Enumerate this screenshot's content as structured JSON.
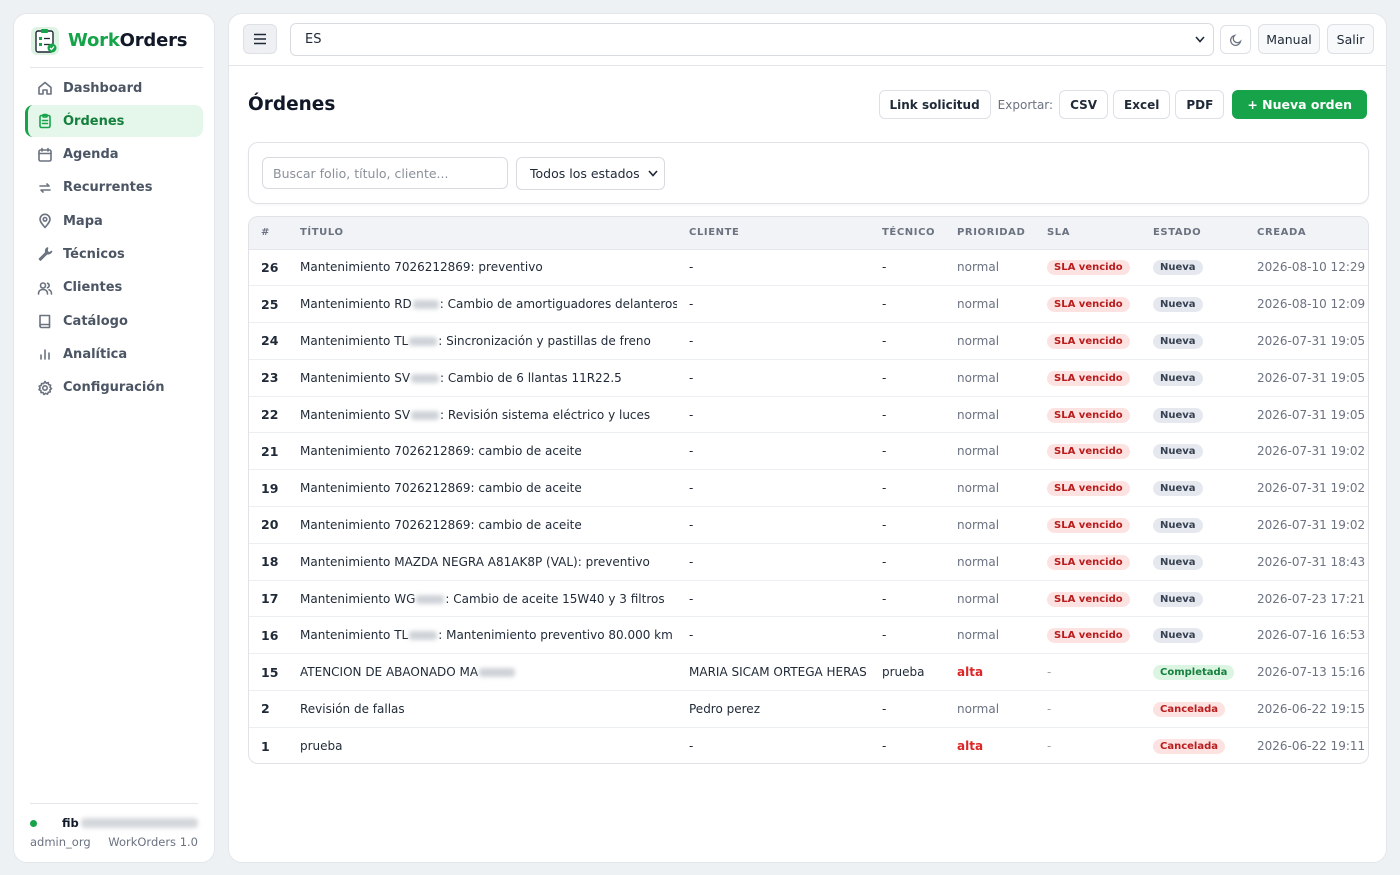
{
  "brand": {
    "name_part1": "Work",
    "name_part2": "Orders"
  },
  "sidebar": {
    "items": [
      {
        "label": "Dashboard",
        "icon": "home-icon"
      },
      {
        "label": "Órdenes",
        "icon": "clipboard-icon",
        "active": true
      },
      {
        "label": "Agenda",
        "icon": "calendar-icon"
      },
      {
        "label": "Recurrentes",
        "icon": "repeat-icon"
      },
      {
        "label": "Mapa",
        "icon": "map-pin-icon"
      },
      {
        "label": "Técnicos",
        "icon": "wrench-icon"
      },
      {
        "label": "Clientes",
        "icon": "users-icon"
      },
      {
        "label": "Catálogo",
        "icon": "book-icon"
      },
      {
        "label": "Analítica",
        "icon": "bar-chart-icon"
      },
      {
        "label": "Configuración",
        "icon": "gear-icon"
      }
    ],
    "user": {
      "name_visible": "fib",
      "role": "admin_org",
      "version": "WorkOrders 1.0"
    }
  },
  "topbar": {
    "language": "ES",
    "manual_label": "Manual",
    "logout_label": "Salir"
  },
  "page": {
    "title": "Órdenes",
    "link_button": "Link solicitud",
    "export_label": "Exportar:",
    "export_csv": "CSV",
    "export_excel": "Excel",
    "export_pdf": "PDF",
    "new_order_button": "+ Nueva orden"
  },
  "filters": {
    "search_placeholder": "Buscar folio, título, cliente...",
    "state_selected": "Todos los estados"
  },
  "table": {
    "columns": [
      "#",
      "TÍTULO",
      "CLIENTE",
      "TÉCNICO",
      "PRIORIDAD",
      "SLA",
      "ESTADO",
      "CREADA"
    ],
    "rows": [
      {
        "id": "26",
        "title_pre": "Mantenimiento 7026212869: preventivo",
        "title_post": "",
        "blur": 0,
        "client": "-",
        "tech": "-",
        "priority": "normal",
        "sla": "SLA vencido",
        "state": "Nueva",
        "state_kind": "nueva",
        "created": "2026-08-10 12:29"
      },
      {
        "id": "25",
        "title_pre": "Mantenimiento RD",
        "title_post": ": Cambio de amortiguadores delanteros",
        "blur": 26,
        "client": "-",
        "tech": "-",
        "priority": "normal",
        "sla": "SLA vencido",
        "state": "Nueva",
        "state_kind": "nueva",
        "created": "2026-08-10 12:09"
      },
      {
        "id": "24",
        "title_pre": "Mantenimiento TL",
        "title_post": ": Sincronización y pastillas de freno",
        "blur": 28,
        "client": "-",
        "tech": "-",
        "priority": "normal",
        "sla": "SLA vencido",
        "state": "Nueva",
        "state_kind": "nueva",
        "created": "2026-07-31 19:05"
      },
      {
        "id": "23",
        "title_pre": "Mantenimiento SV",
        "title_post": ": Cambio de 6 llantas 11R22.5",
        "blur": 28,
        "client": "-",
        "tech": "-",
        "priority": "normal",
        "sla": "SLA vencido",
        "state": "Nueva",
        "state_kind": "nueva",
        "created": "2026-07-31 19:05"
      },
      {
        "id": "22",
        "title_pre": "Mantenimiento SV",
        "title_post": ": Revisión sistema eléctrico y luces",
        "blur": 28,
        "client": "-",
        "tech": "-",
        "priority": "normal",
        "sla": "SLA vencido",
        "state": "Nueva",
        "state_kind": "nueva",
        "created": "2026-07-31 19:05"
      },
      {
        "id": "21",
        "title_pre": "Mantenimiento 7026212869: cambio de aceite",
        "title_post": "",
        "blur": 0,
        "client": "-",
        "tech": "-",
        "priority": "normal",
        "sla": "SLA vencido",
        "state": "Nueva",
        "state_kind": "nueva",
        "created": "2026-07-31 19:02"
      },
      {
        "id": "19",
        "title_pre": "Mantenimiento 7026212869: cambio de aceite",
        "title_post": "",
        "blur": 0,
        "client": "-",
        "tech": "-",
        "priority": "normal",
        "sla": "SLA vencido",
        "state": "Nueva",
        "state_kind": "nueva",
        "created": "2026-07-31 19:02"
      },
      {
        "id": "20",
        "title_pre": "Mantenimiento 7026212869: cambio de aceite",
        "title_post": "",
        "blur": 0,
        "client": "-",
        "tech": "-",
        "priority": "normal",
        "sla": "SLA vencido",
        "state": "Nueva",
        "state_kind": "nueva",
        "created": "2026-07-31 19:02"
      },
      {
        "id": "18",
        "title_pre": "Mantenimiento MAZDA NEGRA A81AK8P (VAL): preventivo",
        "title_post": "",
        "blur": 0,
        "client": "-",
        "tech": "-",
        "priority": "normal",
        "sla": "SLA vencido",
        "state": "Nueva",
        "state_kind": "nueva",
        "created": "2026-07-31 18:43"
      },
      {
        "id": "17",
        "title_pre": "Mantenimiento WG",
        "title_post": ": Cambio de aceite 15W40 y 3 filtros",
        "blur": 28,
        "client": "-",
        "tech": "-",
        "priority": "normal",
        "sla": "SLA vencido",
        "state": "Nueva",
        "state_kind": "nueva",
        "created": "2026-07-23 17:21"
      },
      {
        "id": "16",
        "title_pre": "Mantenimiento TL",
        "title_post": ": Mantenimiento preventivo 80.000 km",
        "blur": 28,
        "client": "-",
        "tech": "-",
        "priority": "normal",
        "sla": "SLA vencido",
        "state": "Nueva",
        "state_kind": "nueva",
        "created": "2026-07-16 16:53"
      },
      {
        "id": "15",
        "title_pre": "ATENCION DE ABAONADO MA",
        "title_post": "",
        "blur": 36,
        "client": "MARIA SICAM ORTEGA HERAS",
        "tech": "prueba",
        "priority": "alta",
        "sla": "-",
        "state": "Completada",
        "state_kind": "completada",
        "created": "2026-07-13 15:16"
      },
      {
        "id": "2",
        "title_pre": "Revisión de fallas",
        "title_post": "",
        "blur": 0,
        "client": "Pedro perez",
        "tech": "-",
        "priority": "normal",
        "sla": "-",
        "state": "Cancelada",
        "state_kind": "cancelada",
        "created": "2026-06-22 19:15"
      },
      {
        "id": "1",
        "title_pre": "prueba",
        "title_post": "",
        "blur": 0,
        "client": "-",
        "tech": "-",
        "priority": "alta",
        "sla": "-",
        "state": "Cancelada",
        "state_kind": "cancelada",
        "created": "2026-06-22 19:11"
      }
    ]
  },
  "colors": {
    "accent": "#16a34a",
    "danger": "#dc2626"
  }
}
